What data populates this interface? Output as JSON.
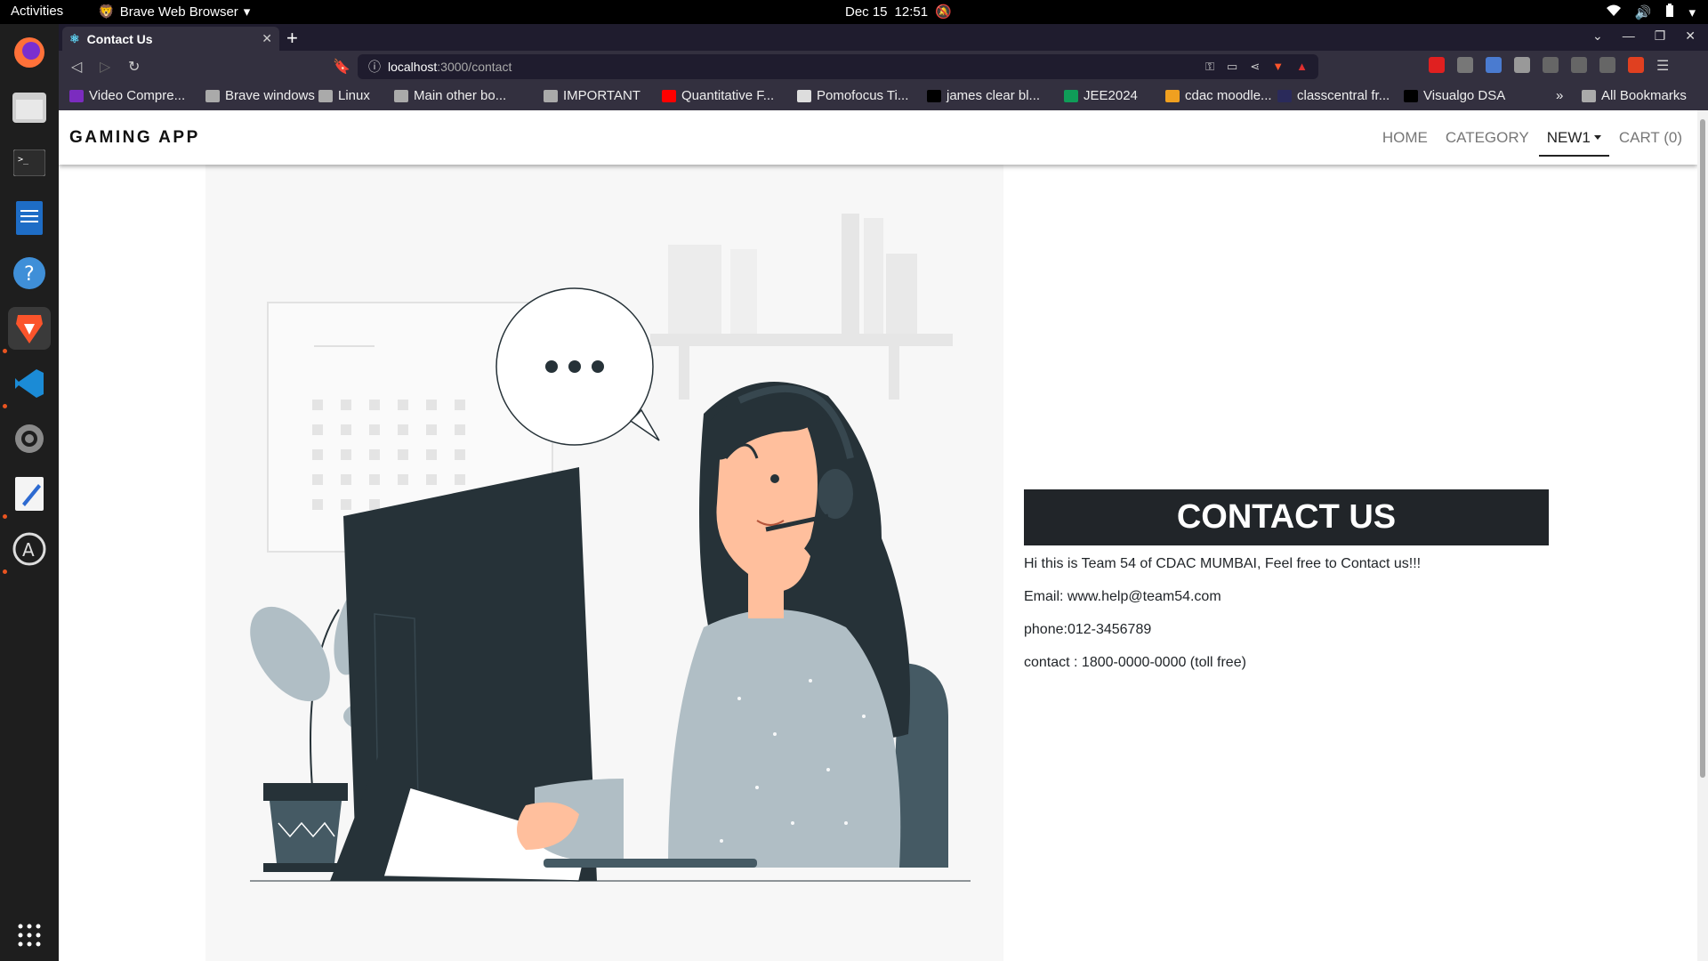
{
  "os": {
    "activities": "Activities",
    "app_menu": "Brave Web Browser",
    "date": "Dec 15",
    "time": "12:51"
  },
  "browser": {
    "tab_title": "Contact Us",
    "url_host": "localhost",
    "url_path": ":3000/contact",
    "bookmarks": [
      {
        "label": "Video Compre...",
        "icon": "video-icon",
        "color": "#7b2cbf"
      },
      {
        "label": "Brave windows",
        "icon": "folder-icon",
        "color": "#aaaaaa"
      },
      {
        "label": "Linux",
        "icon": "folder-icon",
        "color": "#aaaaaa"
      },
      {
        "label": "Main other bo...",
        "icon": "folder-icon",
        "color": "#aaaaaa"
      },
      {
        "label": "IMPORTANT",
        "icon": "folder-icon",
        "color": "#aaaaaa"
      },
      {
        "label": "Quantitative F...",
        "icon": "youtube-icon",
        "color": "#ff0000"
      },
      {
        "label": "Pomofocus Ti...",
        "icon": "check-icon",
        "color": "#dddddd"
      },
      {
        "label": "james clear bl...",
        "icon": "jc-icon",
        "color": "#000000"
      },
      {
        "label": "JEE2024",
        "icon": "sheets-icon",
        "color": "#0f9d58"
      },
      {
        "label": "cdac moodle...",
        "icon": "moodle-icon",
        "color": "#f0a020"
      },
      {
        "label": "classcentral fr...",
        "icon": "classcentral-icon",
        "color": "#2a2a5a"
      },
      {
        "label": "Visualgo DSA",
        "icon": "visualgo-icon",
        "color": "#000000"
      }
    ],
    "overflow": "»",
    "all_bookmarks": "All Bookmarks"
  },
  "site": {
    "brand": "GAMING APP",
    "nav": [
      {
        "label": "HOME",
        "active": false
      },
      {
        "label": "CATEGORY",
        "active": false
      },
      {
        "label": "NEW1",
        "active": true,
        "dropdown": true
      },
      {
        "label": "CART (0)",
        "active": false
      }
    ],
    "contact": {
      "heading": "CONTACT US",
      "intro": "Hi this is Team 54 of CDAC MUMBAI, Feel free to Contact us!!!",
      "email": "Email: www.help@team54.com",
      "phone": "phone:012-3456789",
      "tollfree": "contact : 1800-0000-0000 (toll free)"
    },
    "illustration": "customer-support-woman-illustration"
  }
}
